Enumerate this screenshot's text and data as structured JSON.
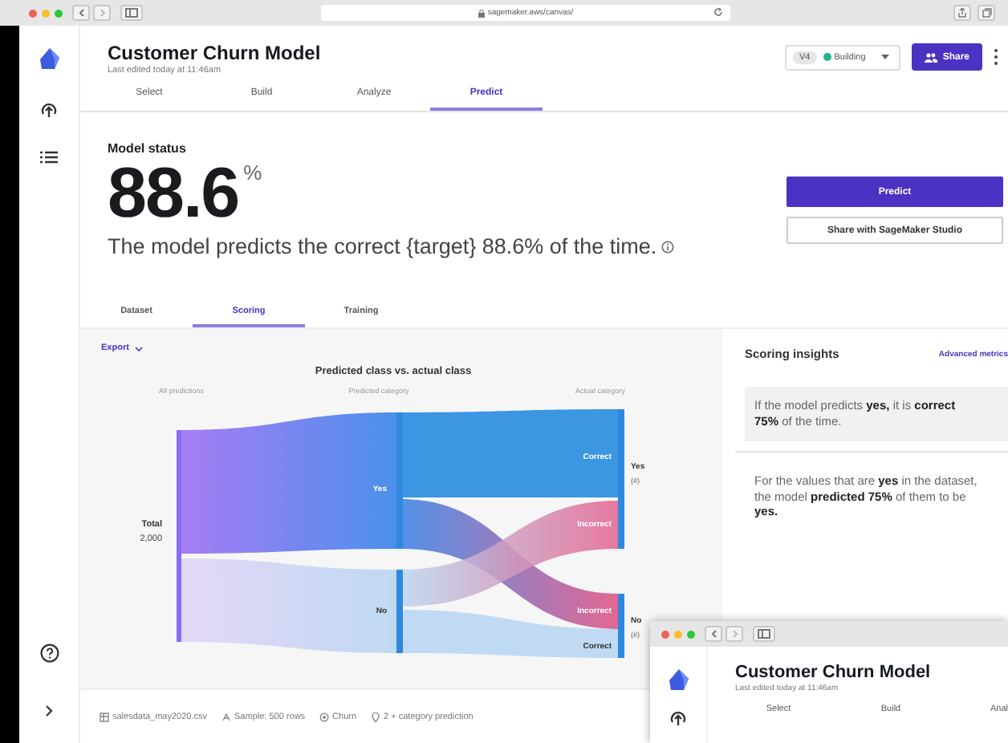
{
  "browser": {
    "url": "sagemaker.aws/canvas/"
  },
  "header": {
    "title": "Customer Churn Model",
    "subtitle": "Last edited today at 11:46am",
    "version": "V4",
    "status": "Building",
    "share_button": "Share"
  },
  "tabs": [
    {
      "label": "Select",
      "selected": false
    },
    {
      "label": "Build",
      "selected": false
    },
    {
      "label": "Analyze",
      "selected": false
    },
    {
      "label": "Predict",
      "selected": true
    }
  ],
  "model_status": {
    "heading": "Model status",
    "score": "88.6",
    "unit": "%",
    "description": "The model predicts the correct {target} 88.6% of the time."
  },
  "actions": [
    {
      "label": "Predict",
      "kind": "primary"
    },
    {
      "label": "Share with SageMaker Studio",
      "kind": "secondary"
    }
  ],
  "subtabs": [
    {
      "label": "Dataset",
      "selected": false
    },
    {
      "label": "Scoring",
      "selected": true
    },
    {
      "label": "Training",
      "selected": false
    }
  ],
  "chart_panel": {
    "export": "Export",
    "title": "Predicted class vs. actual class",
    "column_headings": [
      "All predictions",
      "Predicted category",
      "Actual category"
    ],
    "total_label": "Total",
    "total_value": "2,000",
    "predicted_labels": [
      "Yes",
      "No"
    ],
    "outcome_labels": [
      "Correct",
      "Incorrect",
      "Incorrect",
      "Correct"
    ],
    "actual_labels": [
      {
        "label": "Yes",
        "count": "(#)"
      },
      {
        "label": "No",
        "count": "(#)"
      }
    ]
  },
  "insights": {
    "title": "Scoring insights",
    "link": "Advanced metrics",
    "cards": [
      {
        "text": "If the model predicts **yes,** it is **correct 75%** of the time.",
        "selected": true
      },
      {
        "text": "For the values that are **yes** in the dataset, the model **predicted 75%** of them to be **yes.**",
        "selected": false
      }
    ]
  },
  "footer": [
    {
      "kind": "file",
      "text": "salesdata_may2020.csv"
    },
    {
      "kind": "sample",
      "text": "Sample: 500 rows"
    },
    {
      "kind": "target",
      "text": "Churn"
    },
    {
      "kind": "type",
      "text": "2 + category prediction"
    }
  ],
  "overlay_window": {
    "title": "Customer Churn Model",
    "subtitle": "Last edited today at 11:46am",
    "tabs": [
      "Select",
      "Build",
      "Anal"
    ]
  }
}
